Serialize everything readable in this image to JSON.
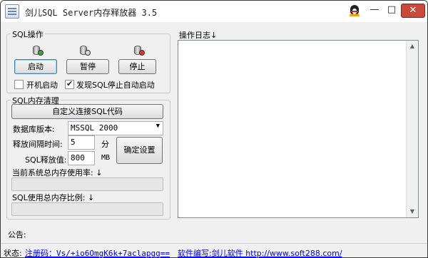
{
  "window": {
    "title": "剑儿SQL Server内存释放器 3.5",
    "minimize_glyph": "—",
    "maximize_glyph": "□",
    "close_glyph": "✕"
  },
  "sql_ops": {
    "group_title": "SQL操作",
    "start_label": "启动",
    "pause_label": "暂停",
    "stop_label": "停止",
    "autostart_label": "开机启动",
    "autostart_checked": false,
    "auto_restart_label": "发现SQL停止自动启动",
    "auto_restart_checked": true
  },
  "memory": {
    "group_title": "SQL内存清理",
    "custom_conn_label": "自定义连接SQL代码",
    "db_version_label": "数据库版本:",
    "db_version_value": "MSSQL 2000",
    "interval_label": "释放间隔时间:",
    "interval_value": "5",
    "interval_unit": "分",
    "release_label": "SQL释放值:",
    "release_value": "800",
    "release_unit": "MB",
    "confirm_label": "确定设置",
    "sys_mem_label": "当前系统总内存使用率: ↓",
    "sql_mem_label": "SQL使用总内存比例: ↓",
    "sys_mem_progress": 0,
    "sql_mem_progress": 0
  },
  "log": {
    "title": "操作日志↓",
    "content": ""
  },
  "notice_label": "公告:",
  "status": {
    "label": "状态:",
    "registration": "注册码：Vs/+io6OmgK6k+7aclapgg==",
    "author": "软件编写:剑儿软件 http://www.soft288.com/"
  },
  "colors": {
    "progress_fill": "#06b025",
    "link": "#0000ee",
    "close_button": "#c74a3b"
  },
  "icons": {
    "start": "database-play-icon",
    "pause": "database-pause-icon",
    "stop": "database-stop-icon"
  }
}
